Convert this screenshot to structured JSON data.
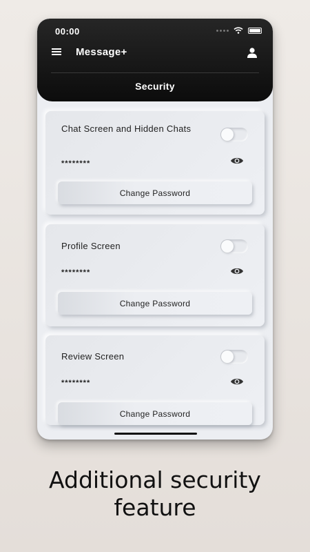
{
  "status_bar": {
    "time": "00:00"
  },
  "header": {
    "app_title": "Message+",
    "section_title": "Security"
  },
  "cards": [
    {
      "label": "Chat Screen and Hidden Chats",
      "password_mask": "********",
      "button_label": "Change Password",
      "toggle_on": false
    },
    {
      "label": "Profile Screen",
      "password_mask": "********",
      "button_label": "Change Password",
      "toggle_on": false
    },
    {
      "label": "Review Screen",
      "password_mask": "********",
      "button_label": "Change Password",
      "toggle_on": false
    }
  ],
  "caption": {
    "line1": "Additional security",
    "line2": "feature"
  },
  "icons": [
    "menu-icon",
    "user-icon",
    "eye-icon",
    "wifi-icon",
    "battery-icon"
  ],
  "colors": {
    "header_bg": "#0c0c0c",
    "card_bg": "#eceef2",
    "page_bg": "#ebe6e1"
  }
}
